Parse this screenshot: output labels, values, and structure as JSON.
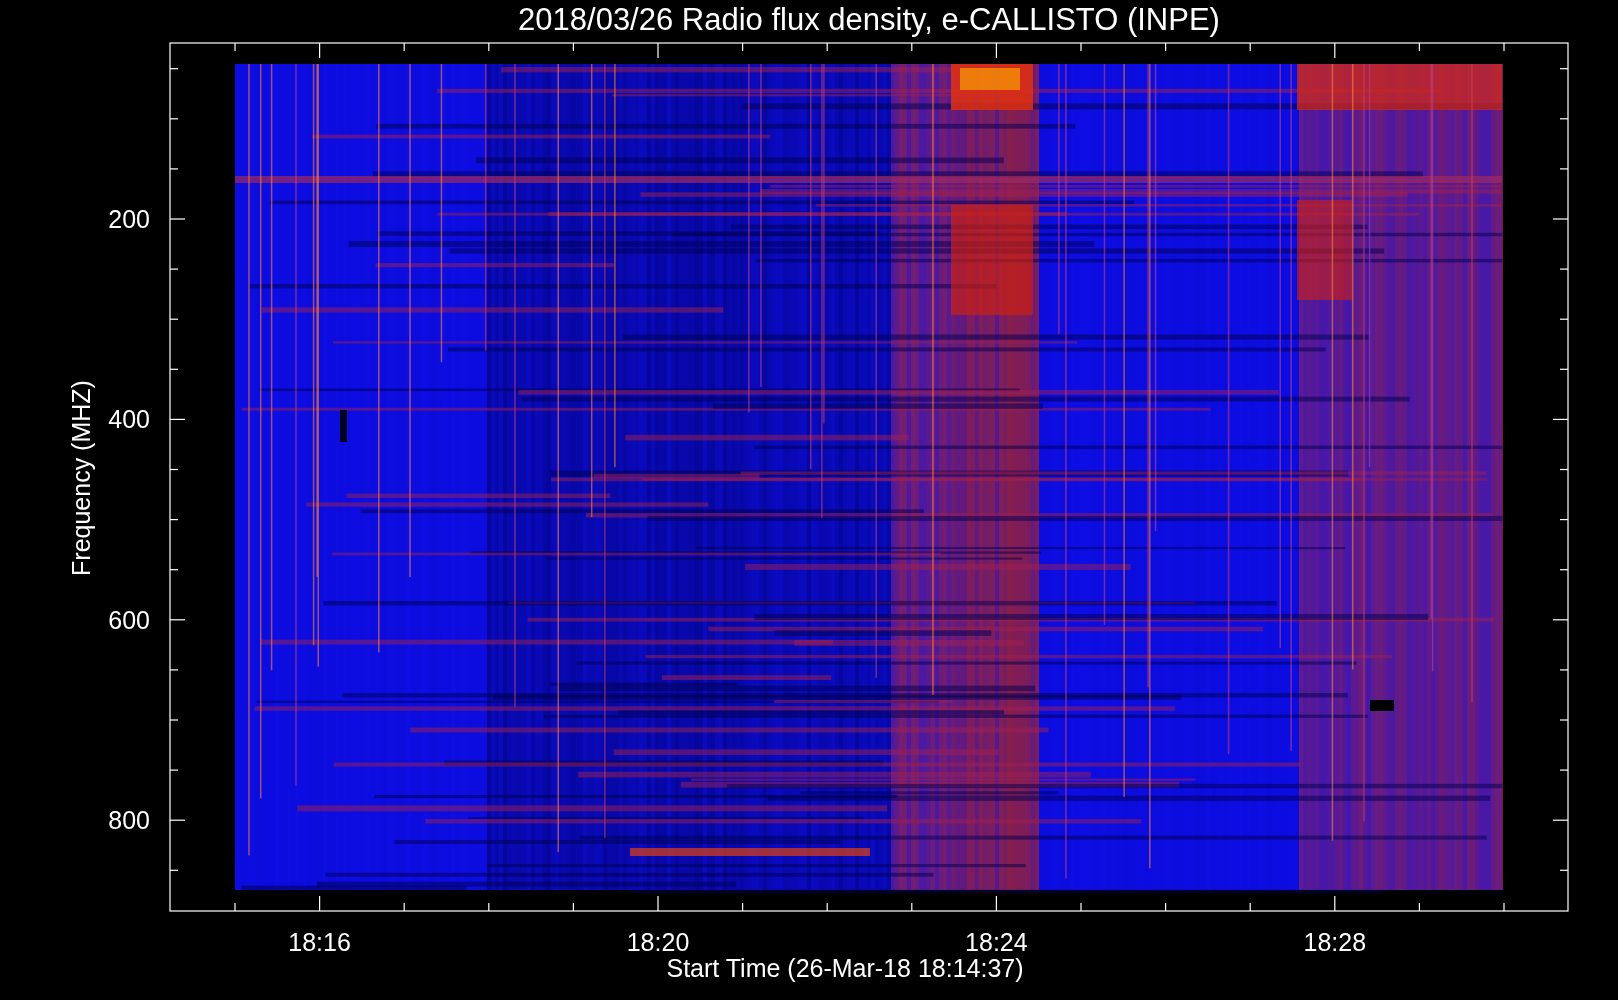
{
  "title": "2018/03/26  Radio flux density, e-CALLISTO (INPE)",
  "y_axis": {
    "label": "Frequency (MHZ)",
    "tick_labels": [
      "200",
      "400",
      "600",
      "800"
    ]
  },
  "x_axis": {
    "label": "Start Time (26-Mar-18 18:14:37)",
    "tick_labels": [
      "18:16",
      "18:20",
      "18:24",
      "18:28"
    ]
  }
}
